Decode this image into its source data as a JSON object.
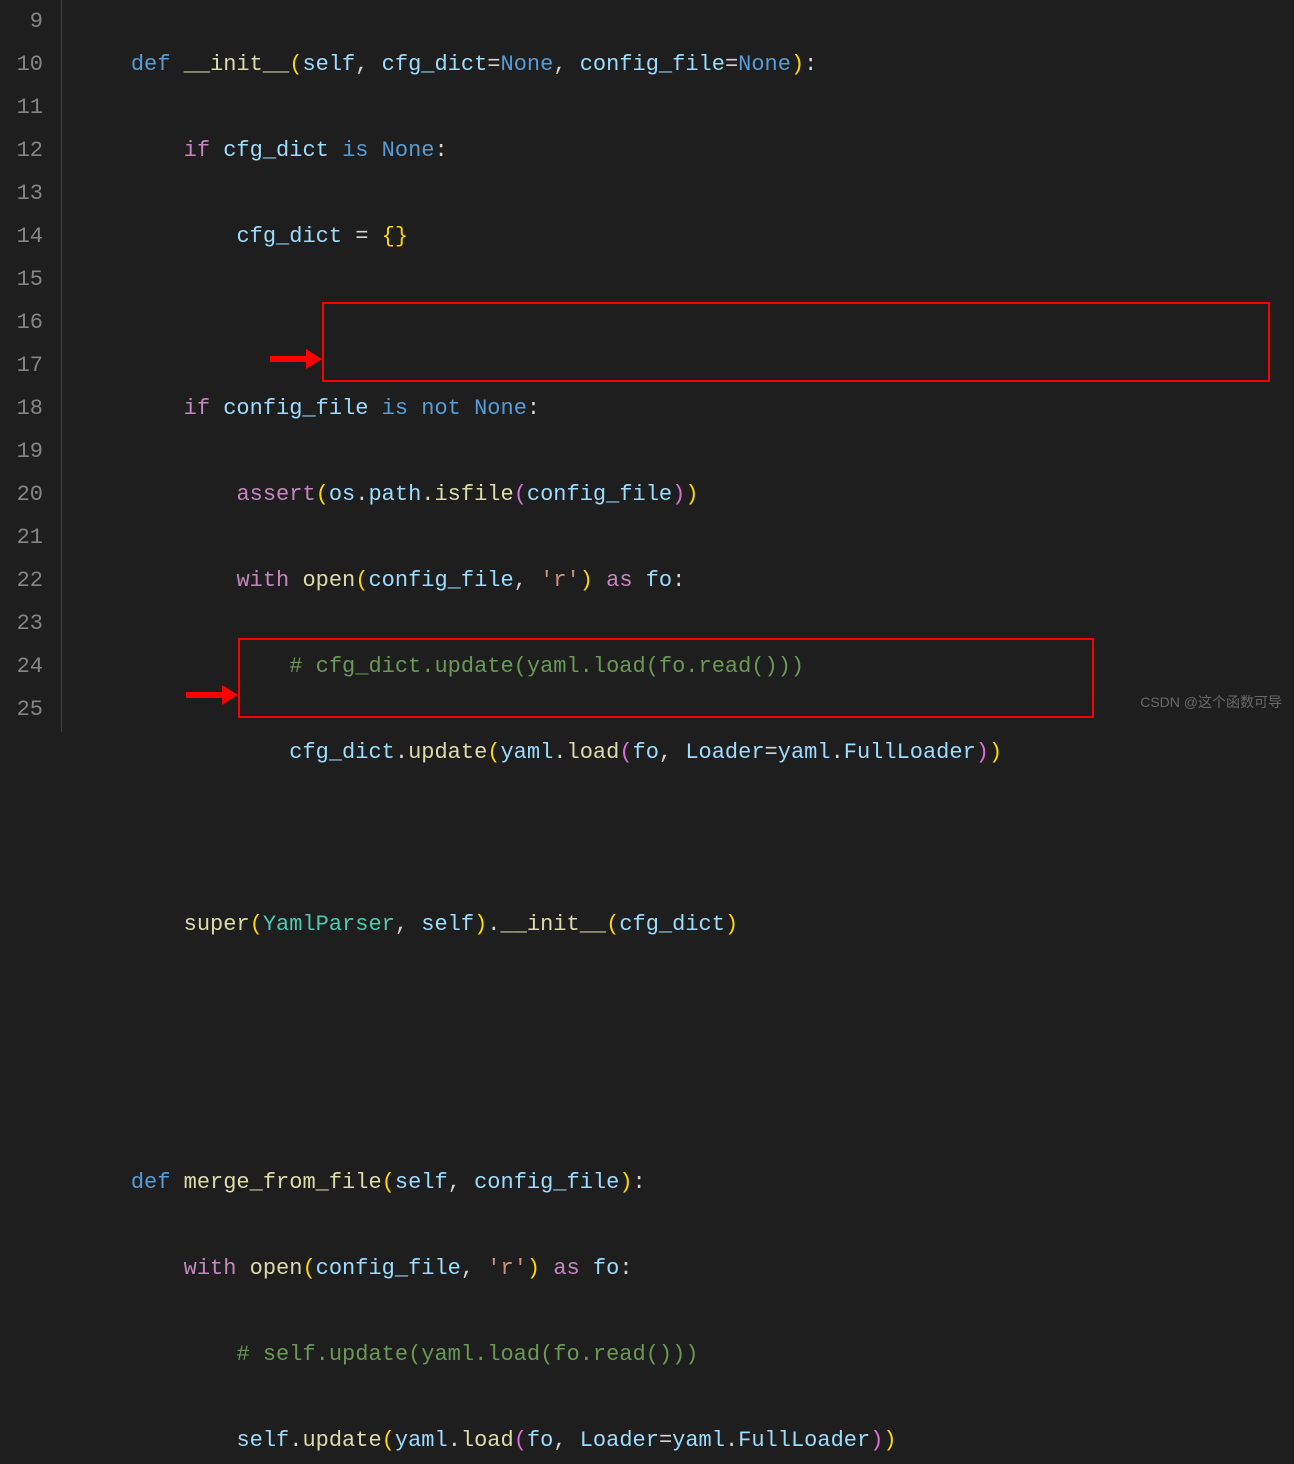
{
  "line_numbers": [
    "9",
    "10",
    "11",
    "12",
    "13",
    "14",
    "15",
    "16",
    "17",
    "18",
    "19",
    "20",
    "21",
    "22",
    "23",
    "24",
    "25"
  ],
  "code": {
    "line9": {
      "def": "def",
      "fname": "__init__",
      "self": "self",
      "p1": "cfg_dict",
      "none1": "None",
      "p2": "config_file",
      "none2": "None"
    },
    "line10": {
      "if": "if",
      "var": "cfg_dict",
      "is": "is",
      "none": "None"
    },
    "line11": {
      "var": "cfg_dict"
    },
    "line13": {
      "if": "if",
      "var": "config_file",
      "is": "is",
      "not": "not",
      "none": "None"
    },
    "line14": {
      "assert": "assert",
      "os": "os",
      "path": "path",
      "isfile": "isfile",
      "arg": "config_file"
    },
    "line15": {
      "with": "with",
      "open": "open",
      "arg": "config_file",
      "str": "'r'",
      "as": "as",
      "fo": "fo"
    },
    "line16": {
      "comment": "# cfg_dict.update(yaml.load(fo.read()))"
    },
    "line17": {
      "var": "cfg_dict",
      "update": "update",
      "yaml": "yaml",
      "load": "load",
      "fo": "fo",
      "loader": "Loader",
      "yaml2": "yaml",
      "full": "FullLoader"
    },
    "line19": {
      "super": "super",
      "cls": "YamlParser",
      "self": "self",
      "init": "__init__",
      "arg": "cfg_dict"
    },
    "line22": {
      "def": "def",
      "fname": "merge_from_file",
      "self": "self",
      "p1": "config_file"
    },
    "line23": {
      "with": "with",
      "open": "open",
      "arg": "config_file",
      "str": "'r'",
      "as": "as",
      "fo": "fo"
    },
    "line24": {
      "comment": "# self.update(yaml.load(fo.read()))"
    },
    "line25": {
      "self": "self",
      "update": "update",
      "yaml": "yaml",
      "load": "load",
      "fo": "fo",
      "loader": "Loader",
      "yaml2": "yaml",
      "full": "FullLoader"
    }
  },
  "watermark": "CSDN @这个函数可导"
}
